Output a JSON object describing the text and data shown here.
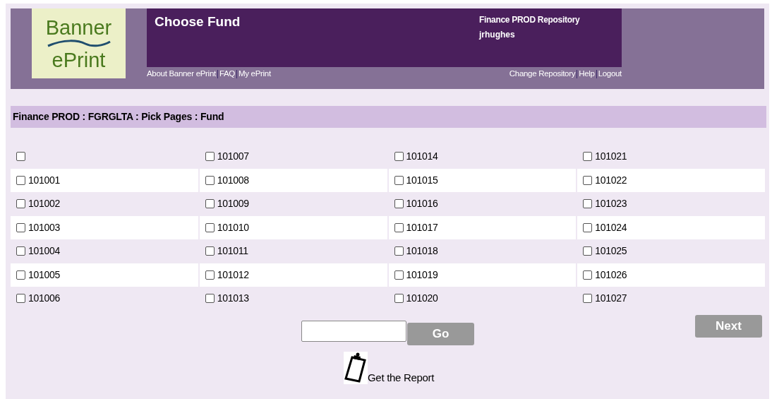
{
  "logo": {
    "top": "Banner",
    "bottom": "ePrint"
  },
  "header": {
    "title": "Choose Fund",
    "repository": "Finance PROD Repository",
    "user": "jrhughes"
  },
  "left_links": [
    "About Banner ePrint",
    "FAQ",
    "My ePrint"
  ],
  "right_links": [
    "Change Repository",
    "Help",
    "Logout"
  ],
  "breadcrumb": "Finance PROD : FGRGLTA : Pick Pages : Fund",
  "rows": [
    [
      {
        "checked": false
      },
      {
        "label": "101007",
        "checked": false
      },
      {
        "label": "101014",
        "checked": false
      },
      {
        "label": "101021",
        "checked": false
      }
    ],
    [
      {
        "label": "101001",
        "checked": false
      },
      {
        "label": "101008",
        "checked": false
      },
      {
        "label": "101015",
        "checked": false
      },
      {
        "label": "101022",
        "checked": false
      }
    ],
    [
      {
        "label": "101002",
        "checked": false
      },
      {
        "label": "101009",
        "checked": false
      },
      {
        "label": "101016",
        "checked": false
      },
      {
        "label": "101023",
        "checked": false
      }
    ],
    [
      {
        "label": "101003",
        "checked": false
      },
      {
        "label": "101010",
        "checked": false
      },
      {
        "label": "101017",
        "checked": false
      },
      {
        "label": "101024",
        "checked": false
      }
    ],
    [
      {
        "label": "101004",
        "checked": false
      },
      {
        "label": "101011",
        "checked": false
      },
      {
        "label": "101018",
        "checked": false
      },
      {
        "label": "101025",
        "checked": false
      }
    ],
    [
      {
        "label": "101005",
        "checked": false
      },
      {
        "label": "101012",
        "checked": false
      },
      {
        "label": "101019",
        "checked": false
      },
      {
        "label": "101026",
        "checked": false
      }
    ],
    [
      {
        "label": "101006",
        "checked": false
      },
      {
        "label": "101013",
        "checked": false
      },
      {
        "label": "101020",
        "checked": false
      },
      {
        "label": "101027",
        "checked": false
      }
    ]
  ],
  "go_button": "Go",
  "next_button": "Next",
  "report_link": "Get the Report"
}
